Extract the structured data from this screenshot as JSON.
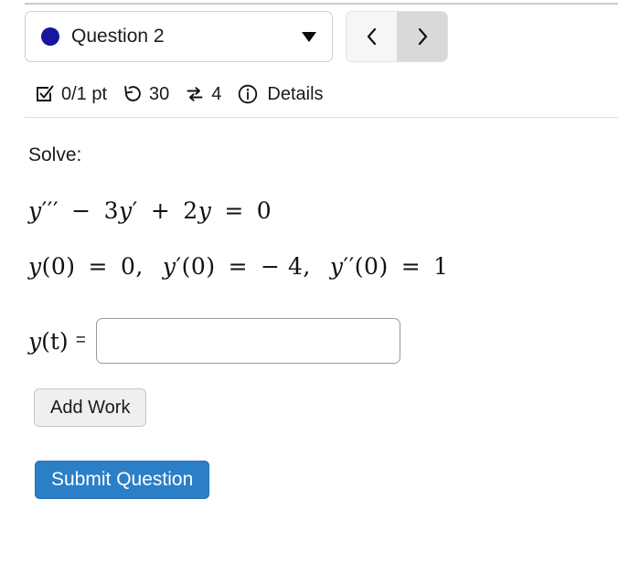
{
  "header": {
    "question_selector": {
      "label": "Question 2",
      "status_dot_color": "#16169e",
      "caret_icon": "chevron-down-icon"
    },
    "nav": {
      "prev_icon": "chevron-left-icon",
      "next_icon": "chevron-right-icon"
    }
  },
  "stats": {
    "score": {
      "icon": "checkbox-checked-icon",
      "value": "0/1 pt"
    },
    "time": {
      "icon": "undo-rotate-icon",
      "value": "30"
    },
    "attempts": {
      "icon": "exchange-arrows-icon",
      "value": "4"
    },
    "details": {
      "icon": "info-circle-icon",
      "label": "Details"
    }
  },
  "content": {
    "prompt": "Solve:",
    "equation_1": {
      "lhs_var": "y",
      "lhs_primes": "′′′",
      "term_1_op": "−",
      "term_1_coeff": "3",
      "term_1_var": "y",
      "term_1_primes": "′",
      "term_2_op": "+",
      "term_2_coeff": "2",
      "term_2_var": "y",
      "equals": "=",
      "rhs": "0",
      "plain": "y''' - 3y' + 2y = 0"
    },
    "equation_2": {
      "ic_1_var": "y",
      "ic_1_primes": "",
      "ic_1_arg": "(0)",
      "ic_1_equals": "=",
      "ic_1_value": "0",
      "ic_1_sep": ",",
      "ic_2_var": "y",
      "ic_2_primes": "′",
      "ic_2_arg": "(0)",
      "ic_2_equals": "=",
      "ic_2_value": "− 4",
      "ic_2_sep": ",",
      "ic_3_var": "y",
      "ic_3_primes": "′′",
      "ic_3_arg": "(0)",
      "ic_3_equals": "=",
      "ic_3_value": "1",
      "plain": "y(0) = 0, y'(0) = -4, y''(0) = 1"
    },
    "answer": {
      "label_var": "y",
      "label_arg": "(t)",
      "label_equals": "=",
      "value": "",
      "placeholder": ""
    }
  },
  "actions": {
    "add_work_label": "Add Work",
    "submit_label": "Submit Question",
    "submit_color": "#2b7fc7"
  }
}
